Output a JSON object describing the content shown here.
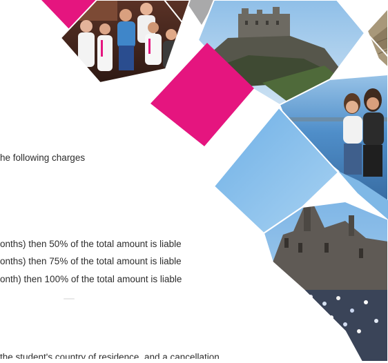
{
  "text_lines": [
    "he following charges",
    "onths) then 50% of the total amount is liable",
    "onths) then 75% of the total amount is liable",
    "onth) then 100% of the total amount is liable",
    "the student's country of residence, and a cancellation"
  ],
  "colors": {
    "magenta": "#e5157f",
    "grey": "#a9a9aa",
    "text": "#2c2c2c",
    "background": "#ffffff"
  },
  "collage": {
    "photos": [
      "group-of-students-photo",
      "edinburgh-castle-photo",
      "stone-wall-photo",
      "two-girls-seaside-photo",
      "blue-sky-tile",
      "parliament-crowd-photo"
    ],
    "accent_tiles": [
      "magenta-tile-top-left",
      "grey-tile-top",
      "magenta-tile-center"
    ]
  }
}
